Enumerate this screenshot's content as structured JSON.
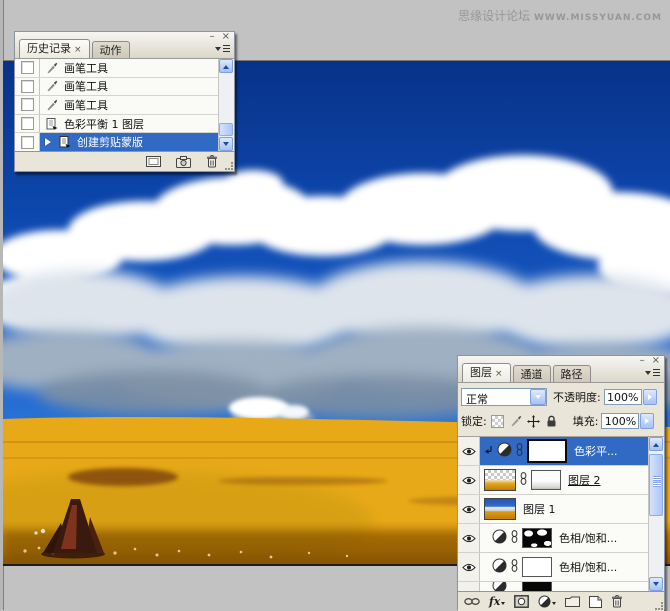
{
  "watermark": {
    "site_name": "思缘设计论坛",
    "site_url": "WWW.MISSYUAN.COM"
  },
  "history_panel": {
    "window": {
      "minimize": "–",
      "close": "×"
    },
    "tabs": [
      {
        "label": "历史记录",
        "close_glyph": "×",
        "active": true
      },
      {
        "label": "动作",
        "active": false
      }
    ],
    "items": [
      {
        "label": "画笔工具",
        "icon": "brush"
      },
      {
        "label": "画笔工具",
        "icon": "brush"
      },
      {
        "label": "画笔工具",
        "icon": "brush"
      },
      {
        "label": "色彩平衡 1 图层",
        "icon": "document"
      },
      {
        "label": "创建剪贴蒙版",
        "icon": "document",
        "selected": true
      }
    ]
  },
  "layers_panel": {
    "window": {
      "minimize": "–",
      "close": "×"
    },
    "tabs": [
      {
        "label": "图层",
        "close_glyph": "×",
        "active": true
      },
      {
        "label": "通道",
        "active": false
      },
      {
        "label": "路径",
        "active": false
      }
    ],
    "blend_mode": "正常",
    "opacity_label": "不透明度:",
    "opacity_value": "100%",
    "lock_label": "锁定:",
    "fill_label": "填充:",
    "fill_value": "100%",
    "layers": [
      {
        "name": "色彩平...",
        "type": "adjustment",
        "selected": true,
        "clipped": true
      },
      {
        "name": "图层 2",
        "type": "image-with-mask"
      },
      {
        "name": "图层 1",
        "type": "image"
      },
      {
        "name": "色相/饱和...",
        "type": "adjustment"
      },
      {
        "name": "色相/饱和...",
        "type": "adjustment"
      }
    ],
    "footer": {
      "fx_label": "fx"
    }
  },
  "colors": {
    "selection_blue": "#316ac5",
    "workspace_gray": "#c2c2c2",
    "sky_top": "#083288",
    "field_gold": "#d08a0c"
  }
}
